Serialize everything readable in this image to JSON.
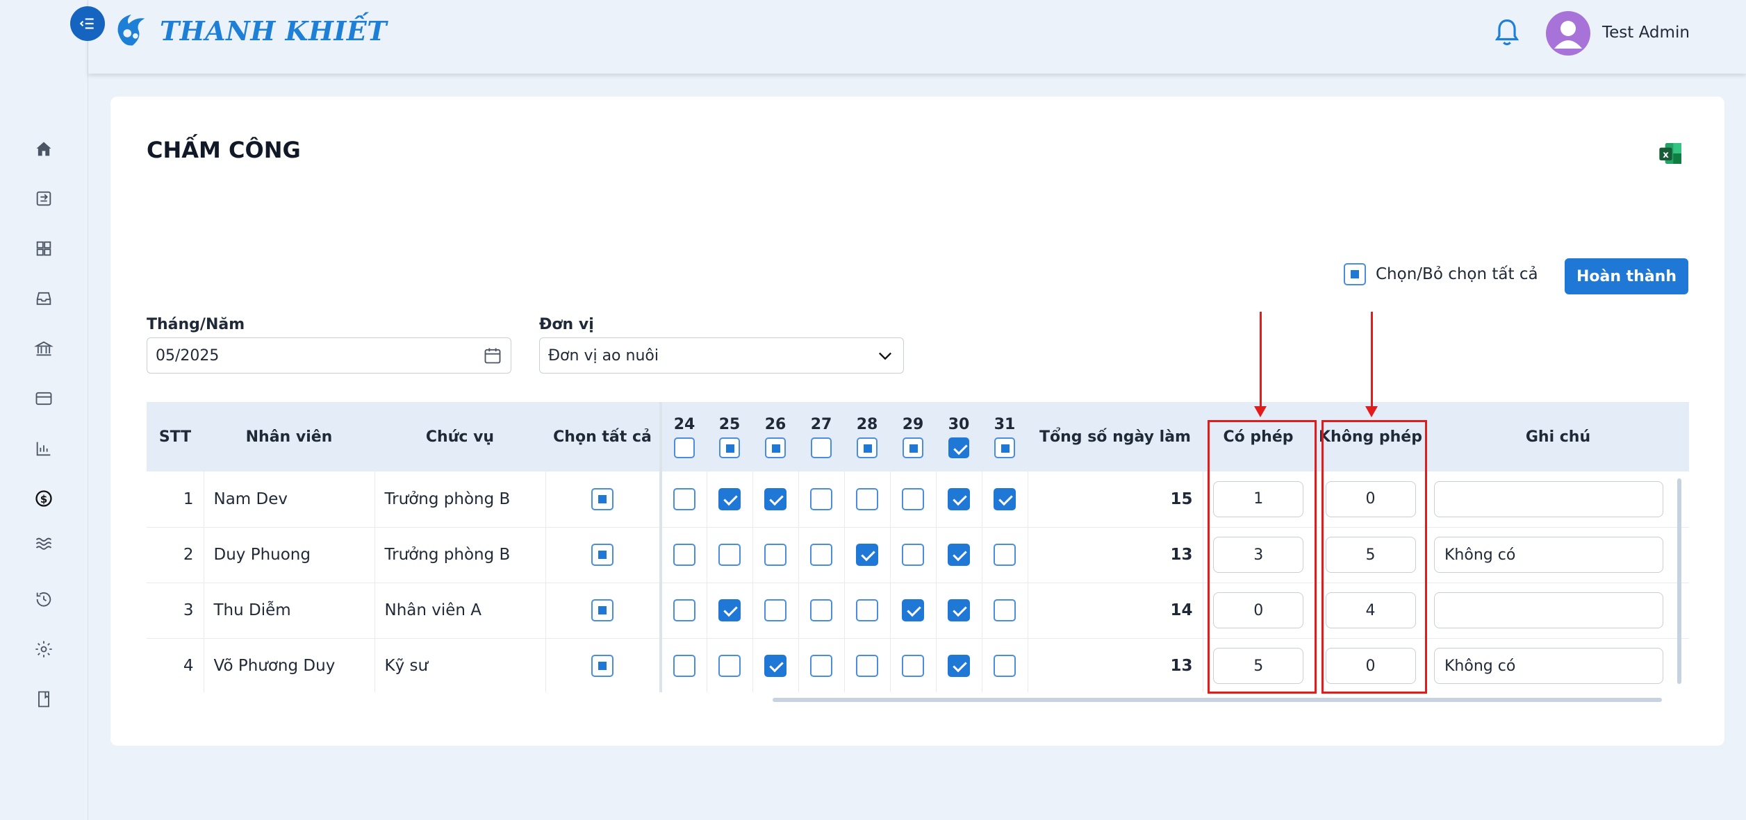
{
  "app": {
    "brand": "THANH KHIẾT",
    "user_name": "Test Admin"
  },
  "sidebar": {
    "items": [
      {
        "icon": "home-icon"
      },
      {
        "icon": "transfer-icon"
      },
      {
        "icon": "grid-icon"
      },
      {
        "icon": "inbox-icon"
      },
      {
        "icon": "bank-icon"
      },
      {
        "icon": "card-icon"
      },
      {
        "icon": "chart-icon"
      },
      {
        "icon": "dollar-icon",
        "active": true
      },
      {
        "icon": "waves-icon"
      },
      {
        "icon": "history-icon"
      },
      {
        "icon": "settings-icon"
      },
      {
        "icon": "book-icon"
      }
    ]
  },
  "page": {
    "title": "CHẤM CÔNG",
    "select_all_label": "Chọn/Bỏ chọn tất cả",
    "done_button": "Hoàn thành",
    "month_label": "Tháng/Năm",
    "month_value": "05/2025",
    "unit_label": "Đơn vị",
    "unit_value": "Đơn vị ao nuôi"
  },
  "table": {
    "headers": {
      "stt": "STT",
      "employee": "Nhân viên",
      "position": "Chức vụ",
      "select_all": "Chọn tất cả",
      "total": "Tổng số ngày làm",
      "with_leave": "Có phép",
      "without_leave": "Không phép",
      "note": "Ghi chú"
    },
    "days": [
      "24",
      "25",
      "26",
      "27",
      "28",
      "29",
      "30",
      "31"
    ],
    "day_header_states": [
      "empty",
      "indet",
      "indet",
      "empty",
      "indet",
      "indet",
      "checked",
      "indet"
    ],
    "rows": [
      {
        "stt": "1",
        "name": "Nam Dev",
        "position": "Trưởng phòng B",
        "days": [
          false,
          true,
          true,
          false,
          false,
          false,
          true,
          true
        ],
        "total": "15",
        "with_leave": "1",
        "without_leave": "0",
        "note": ""
      },
      {
        "stt": "2",
        "name": "Duy Phuong",
        "position": "Trưởng phòng B",
        "days": [
          false,
          false,
          false,
          false,
          true,
          false,
          true,
          false
        ],
        "total": "13",
        "with_leave": "3",
        "without_leave": "5",
        "note": "Không có"
      },
      {
        "stt": "3",
        "name": "Thu Diễm",
        "position": "Nhân viên A",
        "days": [
          false,
          true,
          false,
          false,
          false,
          true,
          true,
          false
        ],
        "total": "14",
        "with_leave": "0",
        "without_leave": "4",
        "note": ""
      },
      {
        "stt": "4",
        "name": "Võ Phương Duy",
        "position": "Kỹ sư",
        "days": [
          false,
          false,
          true,
          false,
          false,
          false,
          true,
          false
        ],
        "total": "13",
        "with_leave": "5",
        "without_leave": "0",
        "note": "Không có"
      }
    ]
  },
  "colors": {
    "primary": "#1f77d6",
    "annotation_red": "#e21b1b",
    "header_bg": "#e4edf7"
  }
}
